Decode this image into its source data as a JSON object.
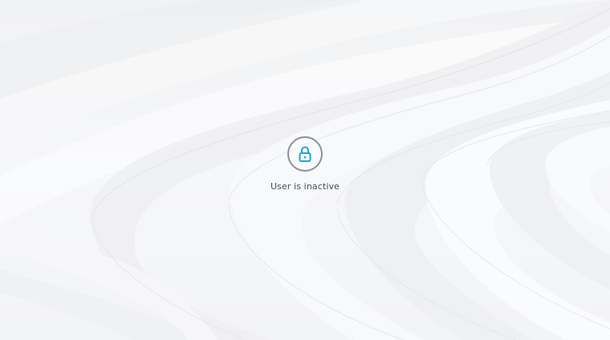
{
  "lock_screen": {
    "status_text": "User is inactive",
    "icon": "lock-icon"
  },
  "colors": {
    "icon_accent": "#1aa6d9",
    "ring": "#8b9097",
    "text": "#4a4d52",
    "background": "#f3f4f6"
  }
}
